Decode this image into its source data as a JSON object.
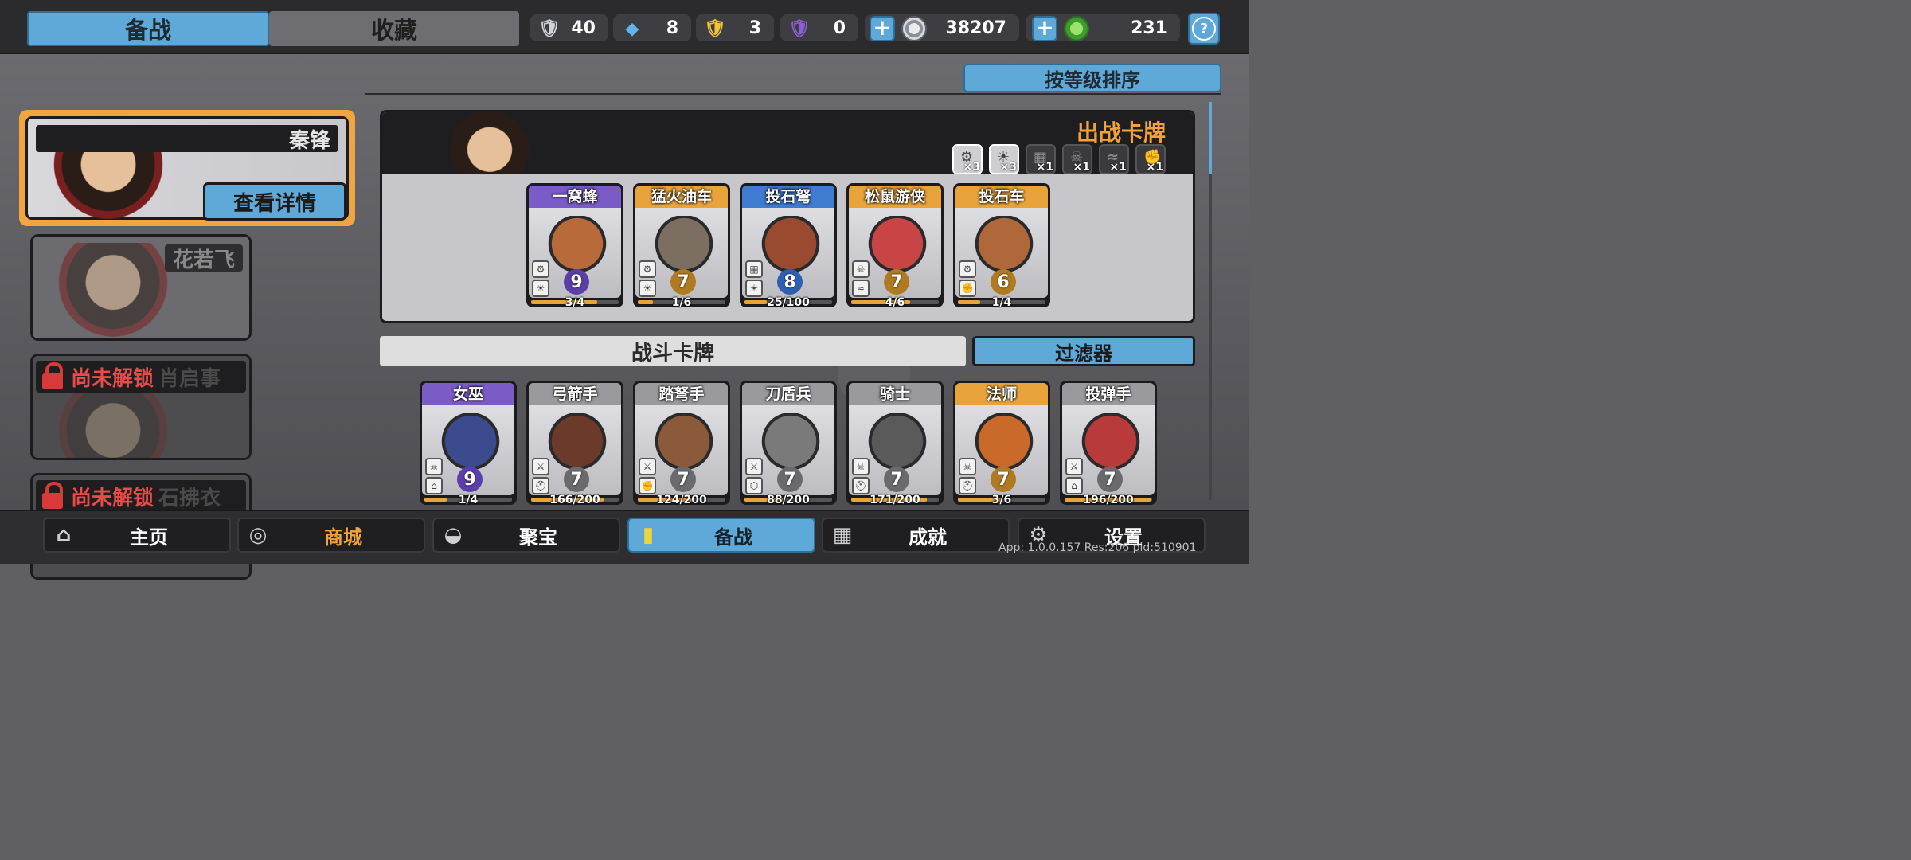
{
  "top_tabs": {
    "active": "备战",
    "inactive": "收藏"
  },
  "resources": [
    {
      "icon": "silver-shield-icon",
      "value": "40"
    },
    {
      "icon": "blue-crystal-icon",
      "value": "8"
    },
    {
      "icon": "gold-shield-icon",
      "value": "3"
    },
    {
      "icon": "purple-shield-icon",
      "value": "0"
    },
    {
      "icon": "silver-coin-icon",
      "value": "38207"
    },
    {
      "icon": "green-gem-icon",
      "value": "231"
    }
  ],
  "help": "?",
  "sort_button": "按等级排序",
  "heroes": [
    {
      "name": "秦锋",
      "detail_button": "查看详情",
      "locked": false
    },
    {
      "name": "花若飞",
      "locked": false
    },
    {
      "name": "肖启事",
      "locked": true,
      "lock_text": "尚未解锁"
    },
    {
      "name": "石拂衣",
      "locked": true,
      "lock_text": "尚未解锁"
    }
  ],
  "deck": {
    "title": "出战卡牌",
    "type_counts": [
      {
        "icon": "gear-icon",
        "mult": "×3",
        "active": true
      },
      {
        "icon": "sun-icon",
        "mult": "×3",
        "active": true
      },
      {
        "icon": "brick-wall-icon",
        "mult": "×1",
        "active": false
      },
      {
        "icon": "skull-icon",
        "mult": "×1",
        "active": false
      },
      {
        "icon": "wind-icon",
        "mult": "×1",
        "active": false
      },
      {
        "icon": "fist-icon",
        "mult": "×1",
        "active": false
      }
    ],
    "cards": [
      {
        "name": "一窝蜂",
        "level": "9",
        "progress": "3/4",
        "fill": 0.75,
        "rarity": "#7b5cc7",
        "art": "#b86a3a",
        "badges": [
          "⚙",
          "☀"
        ]
      },
      {
        "name": "猛火油车",
        "level": "7",
        "progress": "1/6",
        "fill": 0.17,
        "rarity": "#e9a33b",
        "art": "#7d6e62",
        "badges": [
          "⚙",
          "☀"
        ]
      },
      {
        "name": "投石弩",
        "level": "8",
        "progress": "25/100",
        "fill": 0.25,
        "rarity": "#3f7bd1",
        "art": "#9a4b2f",
        "badges": [
          "▦",
          "☀"
        ]
      },
      {
        "name": "松鼠游侠",
        "level": "7",
        "progress": "4/6",
        "fill": 0.67,
        "rarity": "#e9a33b",
        "art": "#c94545",
        "badges": [
          "☠",
          "≈"
        ]
      },
      {
        "name": "投石车",
        "level": "6",
        "progress": "1/4",
        "fill": 0.25,
        "rarity": "#e9a33b",
        "art": "#b0683a",
        "badges": [
          "⚙",
          "✊"
        ]
      }
    ]
  },
  "battle": {
    "title": "战斗卡牌",
    "filter_button": "过滤器",
    "cards": [
      {
        "name": "女巫",
        "level": "9",
        "progress": "1/4",
        "fill": 0.25,
        "rarity": "#7b5cc7",
        "art": "#3b4b8e",
        "badges": [
          "☠",
          "⌂"
        ]
      },
      {
        "name": "弓箭手",
        "level": "7",
        "progress": "166/200",
        "fill": 0.83,
        "rarity": "#9a9a9e",
        "art": "#6b3a2a",
        "badges": [
          "⚔",
          "⛑"
        ]
      },
      {
        "name": "踏弩手",
        "level": "7",
        "progress": "124/200",
        "fill": 0.62,
        "rarity": "#9a9a9e",
        "art": "#8a5a3a",
        "badges": [
          "⚔",
          "✊"
        ]
      },
      {
        "name": "刀盾兵",
        "level": "7",
        "progress": "88/200",
        "fill": 0.44,
        "rarity": "#9a9a9e",
        "art": "#7a7a7a",
        "badges": [
          "⚔",
          "⬡"
        ]
      },
      {
        "name": "骑士",
        "level": "7",
        "progress": "171/200",
        "fill": 0.86,
        "rarity": "#9a9a9e",
        "art": "#5a5a5a",
        "badges": [
          "☠",
          "⛑"
        ]
      },
      {
        "name": "法师",
        "level": "7",
        "progress": "3/6",
        "fill": 0.5,
        "rarity": "#e9a33b",
        "art": "#c96a2a",
        "badges": [
          "☠",
          "⛑"
        ]
      },
      {
        "name": "投弹手",
        "level": "7",
        "progress": "196/200",
        "fill": 0.98,
        "rarity": "#9a9a9e",
        "art": "#b83a3a",
        "badges": [
          "⚔",
          "⌂"
        ]
      }
    ]
  },
  "bottom_nav": [
    {
      "icon": "home-icon",
      "label": "主页",
      "active": false
    },
    {
      "icon": "coins-icon",
      "label": "商城",
      "active": false
    },
    {
      "icon": "treasure-bowl-icon",
      "label": "聚宝",
      "active": false
    },
    {
      "icon": "cards-icon",
      "label": "备战",
      "active": true
    },
    {
      "icon": "achievements-icon",
      "label": "成就",
      "active": false
    },
    {
      "icon": "gear-icon",
      "label": "设置",
      "active": false
    }
  ],
  "build_info": "App: 1.0.0.157 Res:206 pid:510901",
  "colors": {
    "accent": "#5fa9d9",
    "gold": "#f2a23a",
    "locked_red": "#e94a4a"
  }
}
